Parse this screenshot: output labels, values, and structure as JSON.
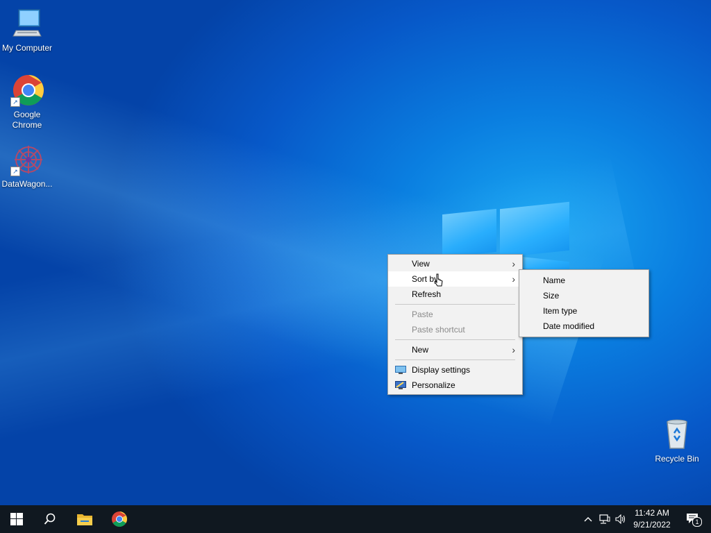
{
  "desktop_icons": [
    {
      "label": "My Computer",
      "icon": "computer-icon"
    },
    {
      "label": "Google Chrome",
      "icon": "chrome-icon"
    },
    {
      "label": "DataWagon...",
      "icon": "datawagon-icon"
    },
    {
      "label": "Recycle Bin",
      "icon": "recycle-bin-icon"
    }
  ],
  "context_menu": {
    "items": [
      {
        "label": "View",
        "submenu": true
      },
      {
        "label": "Sort by",
        "submenu": true,
        "highlighted": true
      },
      {
        "label": "Refresh"
      },
      {
        "label": "Paste",
        "disabled": true
      },
      {
        "label": "Paste shortcut",
        "disabled": true
      },
      {
        "label": "New",
        "submenu": true
      },
      {
        "label": "Display settings",
        "icon": "display-settings-icon"
      },
      {
        "label": "Personalize",
        "icon": "personalize-icon"
      }
    ]
  },
  "sort_submenu": {
    "items": [
      "Name",
      "Size",
      "Item type",
      "Date modified"
    ]
  },
  "taskbar": {
    "clock_time": "11:42 AM",
    "clock_date": "9/21/2022",
    "notification_count": "1",
    "pinned": [
      "start-icon",
      "search-icon",
      "file-explorer-icon",
      "chrome-icon"
    ]
  },
  "colors": {
    "taskbar": "#101820",
    "menu_bg": "#f2f2f2",
    "desktop_accent": "#0a7ee0"
  }
}
